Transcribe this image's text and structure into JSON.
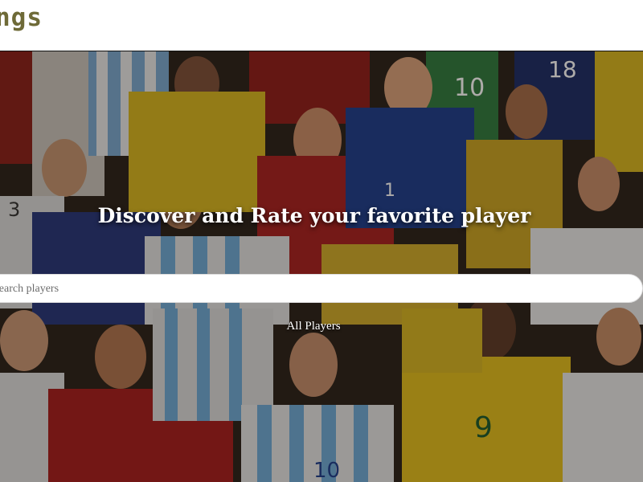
{
  "header": {
    "logo_text": "ngs"
  },
  "hero": {
    "title": "Discover and Rate your favorite player",
    "background": "collage-of-football-players",
    "player_shirt_numbers": [
      "18",
      "10",
      "3",
      "1",
      "9",
      "10"
    ]
  },
  "search": {
    "placeholder": "Search players",
    "value": ""
  },
  "nav": {
    "all_players_label": "All Players"
  },
  "colors": {
    "logo": "#6e6a37",
    "brazil_yellow": "#d8b520",
    "argentina_blue": "#6da9d6",
    "portugal_red": "#a61d1d",
    "france_blue": "#1d2f6b",
    "nigeria_green": "#2d7a3c"
  }
}
